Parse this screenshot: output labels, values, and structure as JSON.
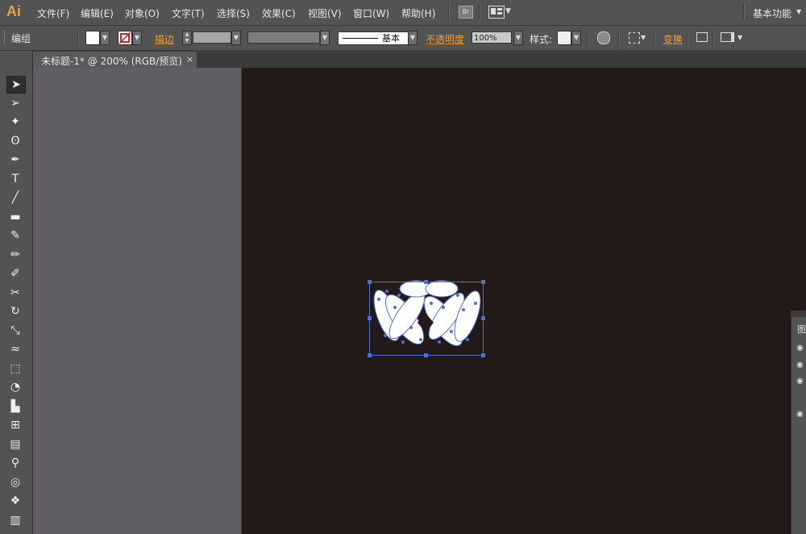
{
  "app": {
    "logo": "Ai"
  },
  "menu": [
    "文件(F)",
    "编辑(E)",
    "对象(O)",
    "文字(T)",
    "选择(S)",
    "效果(C)",
    "视图(V)",
    "窗口(W)",
    "帮助(H)"
  ],
  "bridge_label": "Br",
  "workspace": {
    "label": "基本功能",
    "arrow": "▼"
  },
  "control_bar": {
    "selection_type": "编组",
    "stroke_label": "描边",
    "stroke_style": "基本",
    "opacity_label": "不透明度",
    "opacity_value": "100%",
    "style_label": "样式:",
    "transform_label": "变换"
  },
  "document_tab": {
    "title": "未标题-1* @ 200% (RGB/预览)",
    "close": "×"
  },
  "panel_collapse": "»",
  "tools": [
    "selection-tool",
    "direct-selection-tool",
    "magic-wand-tool",
    "lasso-tool",
    "pen-tool",
    "type-tool",
    "line-tool",
    "rectangle-tool",
    "paintbrush-tool",
    "pencil-tool",
    "blob-brush-tool",
    "scissors-tool",
    "rotate-tool",
    "scale-tool",
    "warp-tool",
    "free-transform-tool",
    "shape-builder-tool",
    "graph-tool",
    "mesh-tool",
    "gradient-tool",
    "eyedropper-tool",
    "blend-tool",
    "symbol-sprayer-tool",
    "column-graph-tool"
  ],
  "colors": {
    "accent": "#f0a030",
    "ui_bg": "#535353",
    "artboard": "#231919",
    "pasteboard": "#605e63",
    "selection": "#4d6fd6"
  },
  "right_panel": {
    "label": "图"
  }
}
